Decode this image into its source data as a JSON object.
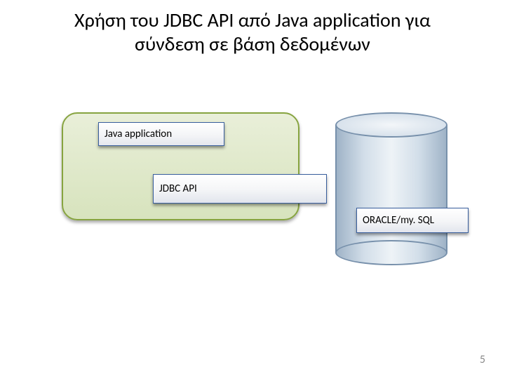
{
  "title_line1": "Χρήση του JDBC API από Java application για",
  "title_line2": "σύνδεση σε βάση δεδομένων",
  "boxes": {
    "java_app": "Java application",
    "jdbc_api": "JDBC API",
    "db_label": "ORACLE/my. SQL"
  },
  "page_number": "5"
}
